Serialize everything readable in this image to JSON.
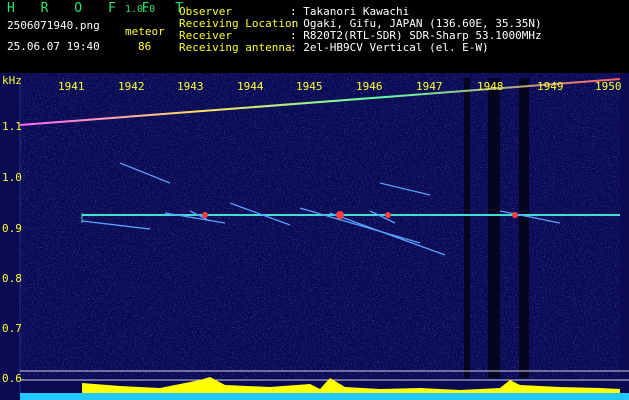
{
  "app": {
    "name": "H R O F F T",
    "version": "1.0.0"
  },
  "left_info": {
    "filename": "2506071940.png",
    "datetime": "25.06.07 19:40",
    "label": "meteor",
    "count": "86"
  },
  "info": [
    {
      "key": "Observer",
      "value": ": Takanori Kawachi"
    },
    {
      "key": "Receiving Location",
      "value": ": Ogaki, Gifu, JAPAN (136.60E, 35.35N)"
    },
    {
      "key": "Receiver",
      "value": ": R820T2(RTL-SDR) SDR-Sharp 53.1000MHz"
    },
    {
      "key": "Receiving antenna",
      "value": ": 2el-HB9CV Vertical (el. E-W)"
    }
  ],
  "plot": {
    "unit": "kHz",
    "y_ticks": [
      "1.1",
      "1.0",
      "0.9",
      "0.8",
      "0.7",
      "0.6"
    ],
    "x_ticks": [
      "1941",
      "1942",
      "1943",
      "1944",
      "1945",
      "1946",
      "1947",
      "1948",
      "1949",
      "1950"
    ],
    "colors": {
      "background": "#0a0a52",
      "axis_text": "#ffff2a",
      "trace": "#3fe0d0",
      "bars": "#ffff00",
      "base": "#22c8ff"
    }
  }
}
